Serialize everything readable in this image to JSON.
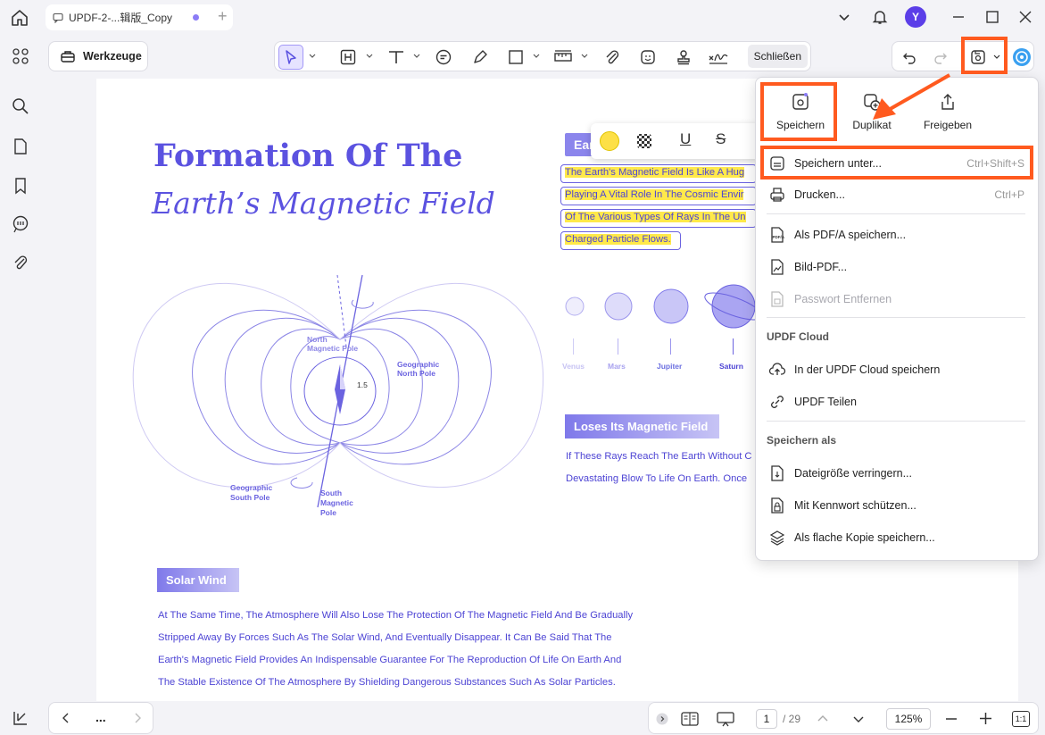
{
  "tab": {
    "title": "UPDF-2-...辑版_Copy"
  },
  "user": {
    "avatar_letter": "Y"
  },
  "toolbar": {
    "werkzeuge": "Werkzeuge",
    "schliessen": "Schließen"
  },
  "document": {
    "title_line1": "Formation Of The",
    "title_line2": "Earth’s Magnetic Field",
    "ear_badge": "Ear",
    "highlighted_lines": [
      "The Earth's Magnetic Field Is Like A Hug",
      "Playing A Vital Role In The Cosmic Envir",
      "Of The Various Types Of Rays In The Un",
      "Charged Particle Flows."
    ],
    "diagram_labels": {
      "north_magnetic_pole": [
        "North",
        "Magnetic Pole"
      ],
      "geographic_north_pole": [
        "Geographic",
        "North Pole"
      ],
      "angle": "1.5",
      "geographic_south_pole": [
        "Geographic",
        "South Pole"
      ],
      "south_magnetic_pole": [
        "South",
        "Magnetic",
        "Pole"
      ]
    },
    "planets": [
      "Venus",
      "Mars",
      "Jupiter",
      "Saturn"
    ],
    "section2_title": "Loses Its Magnetic Field",
    "section2_lines": [
      "If These Rays Reach The Earth Without C",
      "Devastating Blow To Life On Earth. Once"
    ],
    "section3_title": "Solar Wind",
    "section3_lines": [
      "At The Same Time, The Atmosphere Will Also Lose The Protection Of The Magnetic Field And Be Gradually",
      "Stripped Away By Forces Such As The Solar Wind, And Eventually Disappear. It Can Be Said That The",
      "Earth's Magnetic Field Provides An Indispensable Guarantee For The Reproduction Of Life On Earth And",
      "The Stable Existence Of The Atmosphere By Shielding Dangerous Substances Such As Solar Particles."
    ]
  },
  "menu": {
    "top_actions": [
      "Speichern",
      "Duplikat",
      "Freigeben"
    ],
    "items": [
      {
        "label": "Speichern unter...",
        "shortcut": "Ctrl+Shift+S"
      },
      {
        "label": "Drucken...",
        "shortcut": "Ctrl+P"
      },
      {
        "label": "Als PDF/A speichern...",
        "shortcut": ""
      },
      {
        "label": "Bild-PDF...",
        "shortcut": ""
      },
      {
        "label": "Passwort Entfernen",
        "shortcut": ""
      }
    ],
    "cloud_header": "UPDF Cloud",
    "cloud_items": [
      "In der UPDF Cloud speichern",
      "UPDF Teilen"
    ],
    "saveas_header": "Speichern als",
    "saveas_items": [
      "Dateigröße verringern...",
      "Mit Kennwort schützen...",
      "Als flache Kopie speichern..."
    ]
  },
  "pagination": {
    "current": "1",
    "total": "/ 29",
    "zoom": "125%",
    "fit": "1:1",
    "more": "..."
  },
  "colors": {
    "accent": "#5b52e0",
    "annotation": "#ff5a1f",
    "highlight": "#ffe94a"
  }
}
